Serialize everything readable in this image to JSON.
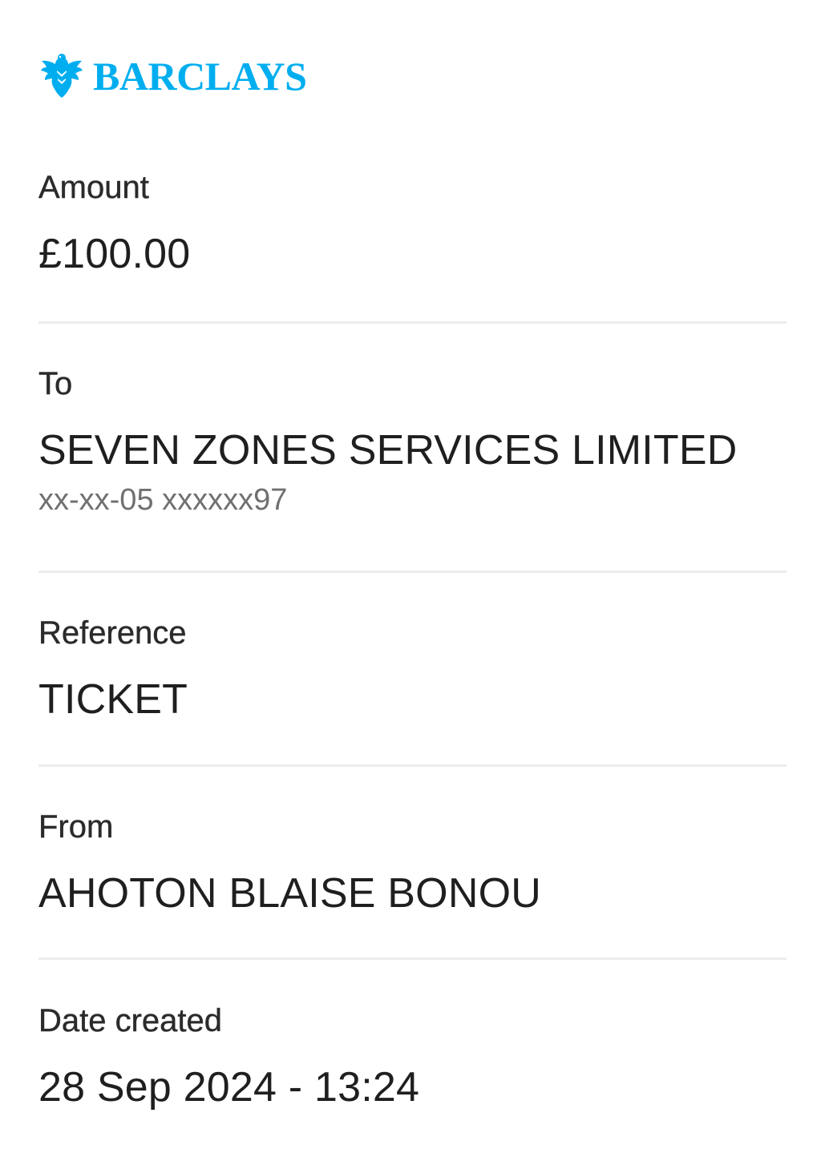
{
  "brand": {
    "name": "BARCLAYS",
    "logo_icon": "eagle-icon",
    "color": "#00aeef"
  },
  "details": {
    "amount": {
      "label": "Amount",
      "value": "£100.00"
    },
    "to": {
      "label": "To",
      "value": "SEVEN ZONES SERVICES LIMITED",
      "account": "xx-xx-05 xxxxxx97"
    },
    "reference": {
      "label": "Reference",
      "value": "TICKET"
    },
    "from": {
      "label": "From",
      "value": "AHOTON BLAISE BONOU"
    },
    "date_created": {
      "label": "Date created",
      "value": "28 Sep 2024 - 13:24"
    }
  },
  "colors": {
    "text_primary": "#1f1f1f",
    "text_secondary": "#707070",
    "divider": "#ececec"
  }
}
